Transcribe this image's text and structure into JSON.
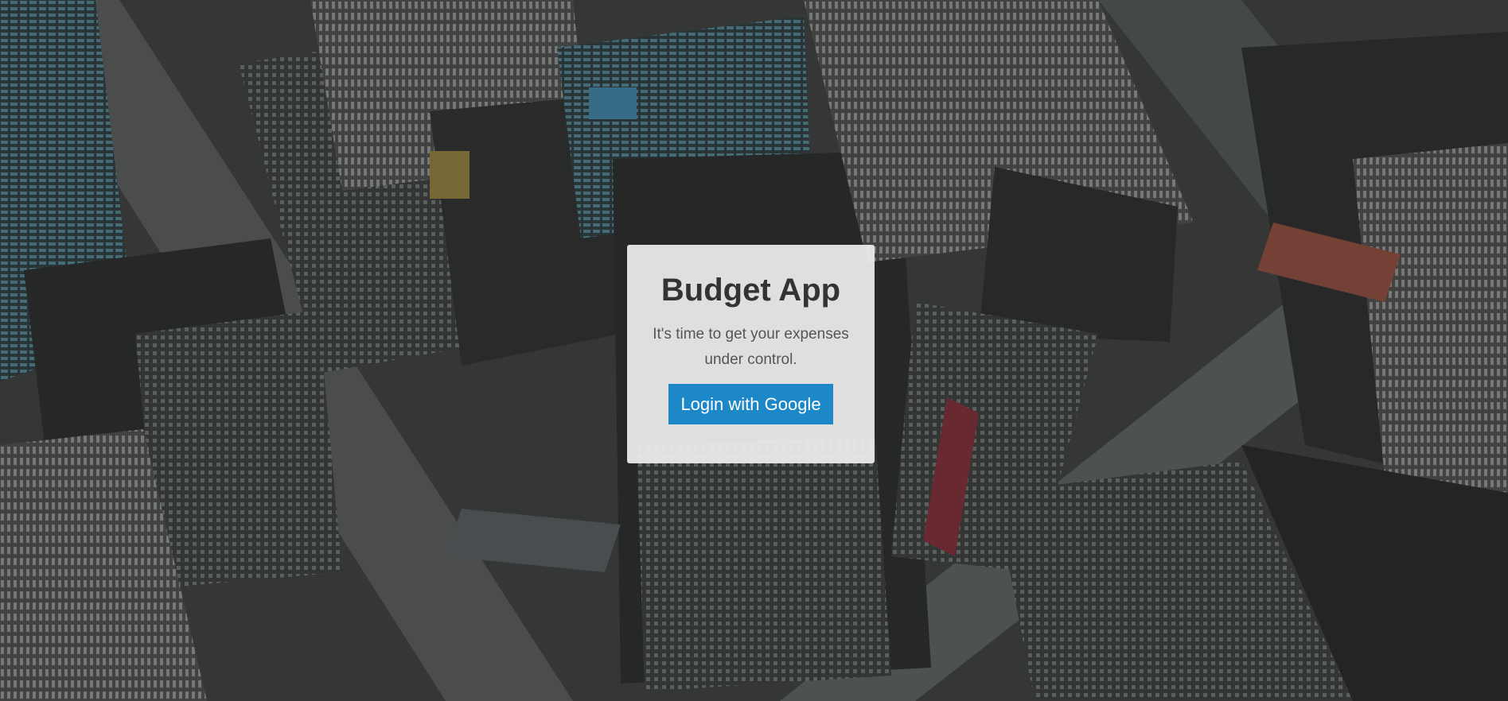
{
  "app": {
    "title": "Budget App",
    "subtitle": "It's time to get your expenses under control."
  },
  "login": {
    "button_label": "Login with Google",
    "button_color": "#1c88c7"
  },
  "background": {
    "description_icon": "city-aerial-photo"
  }
}
